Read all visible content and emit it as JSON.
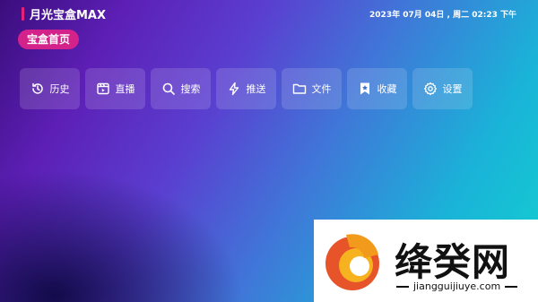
{
  "header": {
    "app_title": "月光宝盒MAX",
    "datetime": "2023年 07月 04日 , 周二 02:23 下午"
  },
  "page": {
    "section_title": "宝盒首页"
  },
  "menu": {
    "items": [
      {
        "label": "历史",
        "icon": "history-icon"
      },
      {
        "label": "直播",
        "icon": "live-tv-icon"
      },
      {
        "label": "搜索",
        "icon": "search-icon"
      },
      {
        "label": "推送",
        "icon": "lightning-icon"
      },
      {
        "label": "文件",
        "icon": "folder-icon"
      },
      {
        "label": "收藏",
        "icon": "bookmark-star-icon"
      },
      {
        "label": "设置",
        "icon": "gear-icon"
      }
    ]
  },
  "watermark": {
    "title": "绛癸网",
    "url": "jiangguijiuye.com"
  },
  "colors": {
    "accent": "#e8207a",
    "pill": "#d3228a",
    "bg_start": "#3a0e7c",
    "bg_end": "#12d0cf"
  }
}
